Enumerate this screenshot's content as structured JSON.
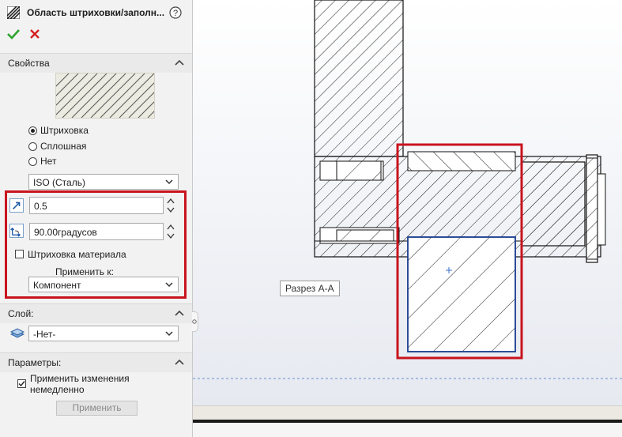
{
  "panel": {
    "title": "Область штриховки/заполн...",
    "icons": {
      "title": "hatch-icon",
      "help": "help-icon",
      "ok": "checkmark-icon",
      "cancel": "close-icon"
    },
    "properties": {
      "header": "Свойства",
      "radios": [
        {
          "label": "Штриховка",
          "selected": true
        },
        {
          "label": "Сплошная",
          "selected": false
        },
        {
          "label": "Нет",
          "selected": false
        }
      ],
      "pattern": "ISO (Сталь)",
      "scale": "0.5",
      "angle": "90.00градусов",
      "material_hatch_label": "Штриховка материала",
      "material_hatch_checked": false,
      "apply_to_label": "Применить к:",
      "apply_to_value": "Компонент"
    },
    "layer": {
      "header": "Слой:",
      "value": "-Нет-"
    },
    "parameters": {
      "header": "Параметры:",
      "apply_immediately_label_line1": "Применить изменения",
      "apply_immediately_label_line2": "немедленно",
      "apply_immediately_checked": true,
      "apply_button": "Применить"
    }
  },
  "canvas": {
    "view_label": "Разрез А-А"
  },
  "colors": {
    "highlight": "#c8141e",
    "accept": "#2ea22e",
    "cancel": "#d42020",
    "selection_edge": "#1b3f8f"
  }
}
